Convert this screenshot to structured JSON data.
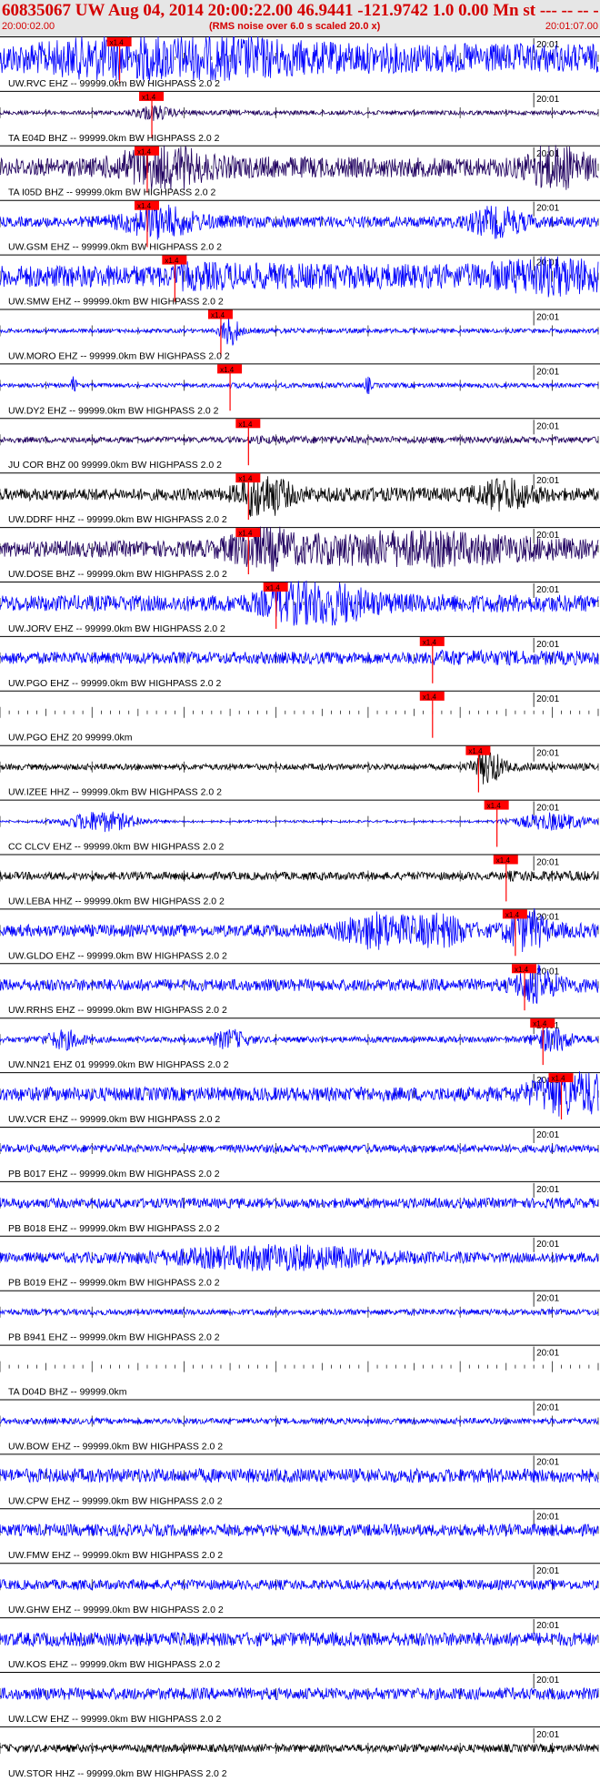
{
  "header": {
    "title": "60835067 UW Aug 04, 2014 20:00:22.00   46.9441 -121.9742  1.0 0.00 Mn st --- -- --  -1",
    "start_time": "20:00:02.00",
    "rms_note": "(RMS noise over 6.0 s scaled 20.0 x)",
    "end_time": "20:01:07.00"
  },
  "colors": {
    "blue": "#0000ff",
    "purple": "#200060",
    "black": "#000000",
    "pick": "#ff0000",
    "header_bg": "#e6e6e6"
  },
  "chart_data": {
    "type": "line",
    "x_range_seconds": [
      0,
      65
    ],
    "minute_tick_label": "20:01",
    "minute_tick_at_seconds": 58,
    "traces": [
      {
        "label": "UW.RVC EHZ -- 99999.0km BW  HIGHPASS  2.0  2",
        "color": "blue",
        "pick": 13,
        "pick_label": "x1.4",
        "amp": 0.7,
        "bursts": [
          [
            18,
            0.9,
            10
          ]
        ]
      },
      {
        "label": "TA E04D BHZ -- 99999.0km BW  HIGHPASS  2.0  2",
        "color": "purple",
        "pick": 16.5,
        "pick_label": "x1.4",
        "amp": 0.1,
        "bursts": [
          [
            16.5,
            0.3,
            2
          ]
        ]
      },
      {
        "label": "TA I05D BHZ -- 99999.0km BW  HIGHPASS  2.0  2",
        "color": "purple",
        "pick": 16,
        "pick_label": "x1.4",
        "amp": 0.45,
        "bursts": [
          [
            17,
            0.9,
            4
          ],
          [
            60.5,
            0.9,
            3
          ]
        ]
      },
      {
        "label": "UW.GSM EHZ -- 99999.0km BW  HIGHPASS  2.0  2",
        "color": "blue",
        "pick": 16,
        "pick_label": "x1.4",
        "amp": 0.25,
        "bursts": [
          [
            17,
            0.6,
            4
          ],
          [
            54,
            0.6,
            3
          ]
        ]
      },
      {
        "label": "UW.SMW EHZ -- 99999.0km BW  HIGHPASS  2.0  2",
        "color": "blue",
        "pick": 19,
        "pick_label": "x1.4",
        "amp": 0.55,
        "bursts": [
          [
            60,
            0.5,
            6
          ]
        ]
      },
      {
        "label": "UW.MORO EHZ -- 99999.0km BW  HIGHPASS  2.0  2",
        "color": "blue",
        "pick": 24,
        "pick_label": "x1.4",
        "amp": 0.1,
        "bursts": [
          [
            25,
            0.7,
            1
          ]
        ]
      },
      {
        "label": "UW.DY2 EHZ -- 99999.0km BW  HIGHPASS  2.0  2",
        "color": "blue",
        "pick": 25,
        "pick_label": "x1.4",
        "amp": 0.1,
        "bursts": [
          [
            8,
            0.4,
            0.3
          ],
          [
            40,
            0.4,
            0.3
          ]
        ]
      },
      {
        "label": "JU COR BHZ 00 99999.0km BW  HIGHPASS  2.0  2",
        "color": "purple",
        "pick": 27,
        "pick_label": "x1.4",
        "amp": 0.15,
        "bursts": []
      },
      {
        "label": "UW.DDRF HHZ -- 99999.0km BW  HIGHPASS  2.0  2",
        "color": "black",
        "pick": 27,
        "pick_label": "x1.4",
        "amp": 0.3,
        "bursts": [
          [
            28.5,
            0.95,
            2.5
          ],
          [
            55,
            0.6,
            3
          ]
        ]
      },
      {
        "label": "UW.DOSE BHZ -- 99999.0km BW  HIGHPASS  2.0  2",
        "color": "purple",
        "pick": 27,
        "pick_label": "x1.4",
        "amp": 0.4,
        "bursts": [
          [
            28,
            0.8,
            3
          ],
          [
            45,
            0.5,
            14
          ]
        ]
      },
      {
        "label": "UW.JORV EHZ -- 99999.0km BW  HIGHPASS  2.0  2",
        "color": "blue",
        "pick": 30,
        "pick_label": "x1.4",
        "amp": 0.4,
        "bursts": [
          [
            34,
            0.95,
            5
          ]
        ]
      },
      {
        "label": "UW.PGO EHZ -- 99999.0km BW  HIGHPASS  2.0  2",
        "color": "blue",
        "pick": 47,
        "pick_label": "x1.4",
        "amp": 0.3,
        "bursts": []
      },
      {
        "label": "UW.PGO EHZ 20 99999.0km",
        "color": "blue",
        "pick": 47,
        "pick_label": "x1.4",
        "amp": 0,
        "bursts": []
      },
      {
        "label": "UW.IZEE HHZ -- 99999.0km BW  HIGHPASS  2.0  2",
        "color": "black",
        "pick": 52,
        "pick_label": "x1.4",
        "amp": 0.15,
        "bursts": [
          [
            53,
            0.8,
            1.5
          ]
        ]
      },
      {
        "label": "CC CLCV EHZ -- 99999.0km BW  HIGHPASS  2.0  2",
        "color": "blue",
        "pick": 54,
        "pick_label": "x1.4",
        "amp": 0.05,
        "bursts": [
          [
            11,
            0.5,
            4
          ],
          [
            60,
            0.4,
            4
          ]
        ]
      },
      {
        "label": "UW.LEBA HHZ -- 99999.0km BW  HIGHPASS  2.0  2",
        "color": "black",
        "pick": 55,
        "pick_label": "x1.4",
        "amp": 0.2,
        "bursts": []
      },
      {
        "label": "UW.GLDO EHZ -- 99999.0km BW  HIGHPASS  2.0  2",
        "color": "blue",
        "pick": 56,
        "pick_label": "x1.4",
        "amp": 0.3,
        "bursts": [
          [
            41,
            0.7,
            4
          ],
          [
            48,
            0.6,
            3
          ],
          [
            57,
            0.95,
            2
          ]
        ]
      },
      {
        "label": "UW.RRHS EHZ -- 99999.0km BW  HIGHPASS  2.0  2",
        "color": "blue",
        "pick": 57,
        "pick_label": "x1.4",
        "amp": 0.3,
        "bursts": [
          [
            58,
            0.7,
            2
          ]
        ]
      },
      {
        "label": "UW.NN21 EHZ 01 99999.0km BW  HIGHPASS  2.0  2",
        "color": "blue",
        "pick": 59,
        "pick_label": "x1.4",
        "amp": 0.15,
        "bursts": [
          [
            7,
            0.4,
            2
          ],
          [
            25,
            0.4,
            2
          ],
          [
            60,
            0.5,
            2
          ]
        ]
      },
      {
        "label": "UW.VCR EHZ -- 99999.0km BW  HIGHPASS  2.0  2",
        "color": "blue",
        "pick": 61,
        "pick_label": "x1.4",
        "amp": 0.35,
        "bursts": [
          [
            62,
            1,
            4
          ]
        ]
      },
      {
        "label": "PB B017 EHZ -- 99999.0km BW  HIGHPASS  2.0  2",
        "color": "blue",
        "pick": null,
        "amp": 0.2,
        "bursts": []
      },
      {
        "label": "PB B018 EHZ -- 99999.0km BW  HIGHPASS  2.0  2",
        "color": "blue",
        "pick": null,
        "amp": 0.25,
        "bursts": []
      },
      {
        "label": "PB B019 EHZ -- 99999.0km BW  HIGHPASS  2.0  2",
        "color": "blue",
        "pick": null,
        "amp": 0.25,
        "bursts": [
          [
            30,
            0.45,
            12
          ]
        ]
      },
      {
        "label": "PB B941 EHZ -- 99999.0km BW  HIGHPASS  2.0  2",
        "color": "blue",
        "pick": null,
        "amp": 0.15,
        "bursts": []
      },
      {
        "label": "TA D04D BHZ -- 99999.0km",
        "color": "blue",
        "pick": null,
        "amp": 0,
        "bursts": []
      },
      {
        "label": "UW.BOW EHZ -- 99999.0km BW  HIGHPASS  2.0  2",
        "color": "blue",
        "pick": null,
        "amp": 0.15,
        "bursts": []
      },
      {
        "label": "UW.CPW EHZ -- 99999.0km BW  HIGHPASS  2.0  2",
        "color": "blue",
        "pick": null,
        "amp": 0.35,
        "bursts": []
      },
      {
        "label": "UW.FMW EHZ -- 99999.0km BW  HIGHPASS  2.0  2",
        "color": "blue",
        "pick": null,
        "amp": 0.3,
        "bursts": []
      },
      {
        "label": "UW.GHW EHZ -- 99999.0km BW  HIGHPASS  2.0  2",
        "color": "blue",
        "pick": null,
        "amp": 0.25,
        "bursts": []
      },
      {
        "label": "UW.KOS EHZ -- 99999.0km BW  HIGHPASS  2.0  2",
        "color": "blue",
        "pick": null,
        "amp": 0.35,
        "bursts": []
      },
      {
        "label": "UW.LCW EHZ -- 99999.0km BW  HIGHPASS  2.0  2",
        "color": "blue",
        "pick": null,
        "amp": 0.3,
        "bursts": []
      },
      {
        "label": "UW.STOR HHZ -- 99999.0km BW  HIGHPASS  2.0  2",
        "color": "black",
        "pick": null,
        "amp": 0.2,
        "bursts": []
      }
    ]
  }
}
